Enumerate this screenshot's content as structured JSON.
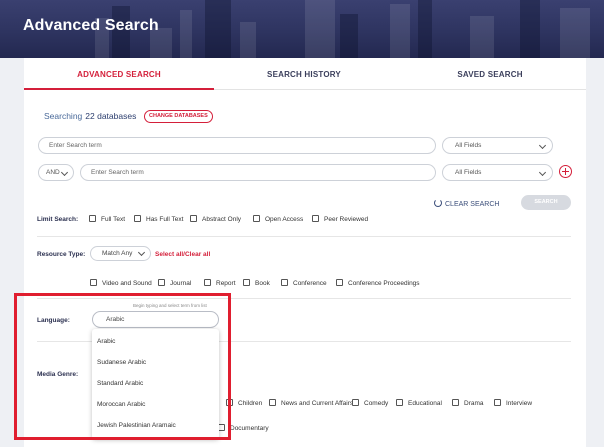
{
  "header": {
    "title": "Advanced Search"
  },
  "tabs": [
    {
      "label": "ADVANCED SEARCH",
      "active": true
    },
    {
      "label": "SEARCH HISTORY",
      "active": false
    },
    {
      "label": "SAVED SEARCH",
      "active": false
    }
  ],
  "searching": {
    "prefix": "Searching",
    "count": "22 databases",
    "change_label": "CHANGE DATABASES"
  },
  "search_rows": [
    {
      "placeholder": "Enter Search term",
      "field": "All Fields"
    },
    {
      "operator": "AND",
      "placeholder": "Enter Search term",
      "field": "All Fields"
    }
  ],
  "actions": {
    "clear_label": "CLEAR SEARCH",
    "search_label": "SEARCH"
  },
  "limit_search": {
    "label": "Limit Search:",
    "options": [
      "Full Text",
      "Has Full Text",
      "Abstract Only",
      "Open Access",
      "Peer Reviewed"
    ]
  },
  "resource_type": {
    "label": "Resource Type:",
    "match": "Match Any",
    "select_all": "Select all/Clear all",
    "options": [
      "Video and Sound",
      "Journal",
      "Report",
      "Book",
      "Conference",
      "Conference Proceedings"
    ]
  },
  "language": {
    "label": "Language:",
    "hint": "Begin typing and select term from list",
    "value": "Arabic",
    "suggestions": [
      "Arabic",
      "Sudanese Arabic",
      "Standard Arabic",
      "Moroccan Arabic",
      "Jewish Palestinian Aramaic"
    ]
  },
  "media_genre": {
    "label": "Media Genre:",
    "options_row1": [
      "Children",
      "News and Current Affairs",
      "Comedy",
      "Educational",
      "Drama",
      "Interview"
    ],
    "options_row2": [
      "Documentary"
    ]
  },
  "colors": {
    "accent": "#d41f3a",
    "navy": "#2e3460",
    "highlight": "#e01e2f"
  }
}
